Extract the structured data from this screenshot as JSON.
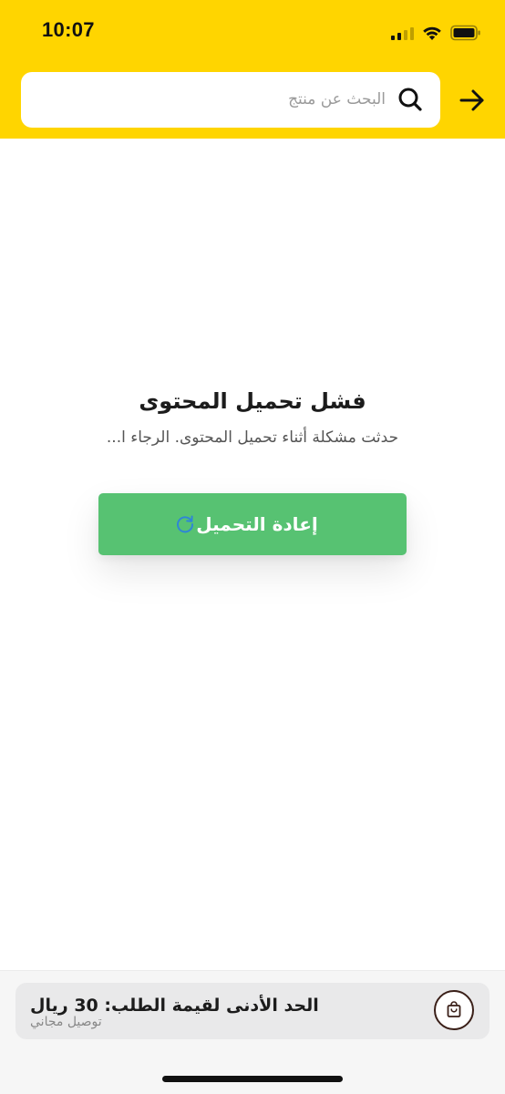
{
  "status_bar": {
    "time": "10:07"
  },
  "search": {
    "placeholder": "البحث عن منتج",
    "value": "",
    "icon": "search-icon"
  },
  "header": {
    "back_icon": "arrow-right-icon"
  },
  "error": {
    "title": "فشل تحميل المحتوى",
    "message": "حدثت مشكلة أثناء تحميل المحتوى. الرجاء ا...",
    "reload_label": "إعادة التحميل",
    "reload_icon": "refresh-icon"
  },
  "bottom_bar": {
    "min_order_title": "الحد الأدنى لقيمة الطلب: 30 ريال",
    "min_order_subtitle": "توصيل مجاني",
    "cart_icon": "shopping-bag-icon"
  },
  "colors": {
    "brand_yellow": "#ffd500",
    "reload_green": "#57c272",
    "refresh_icon_blue": "#2f86d6"
  }
}
